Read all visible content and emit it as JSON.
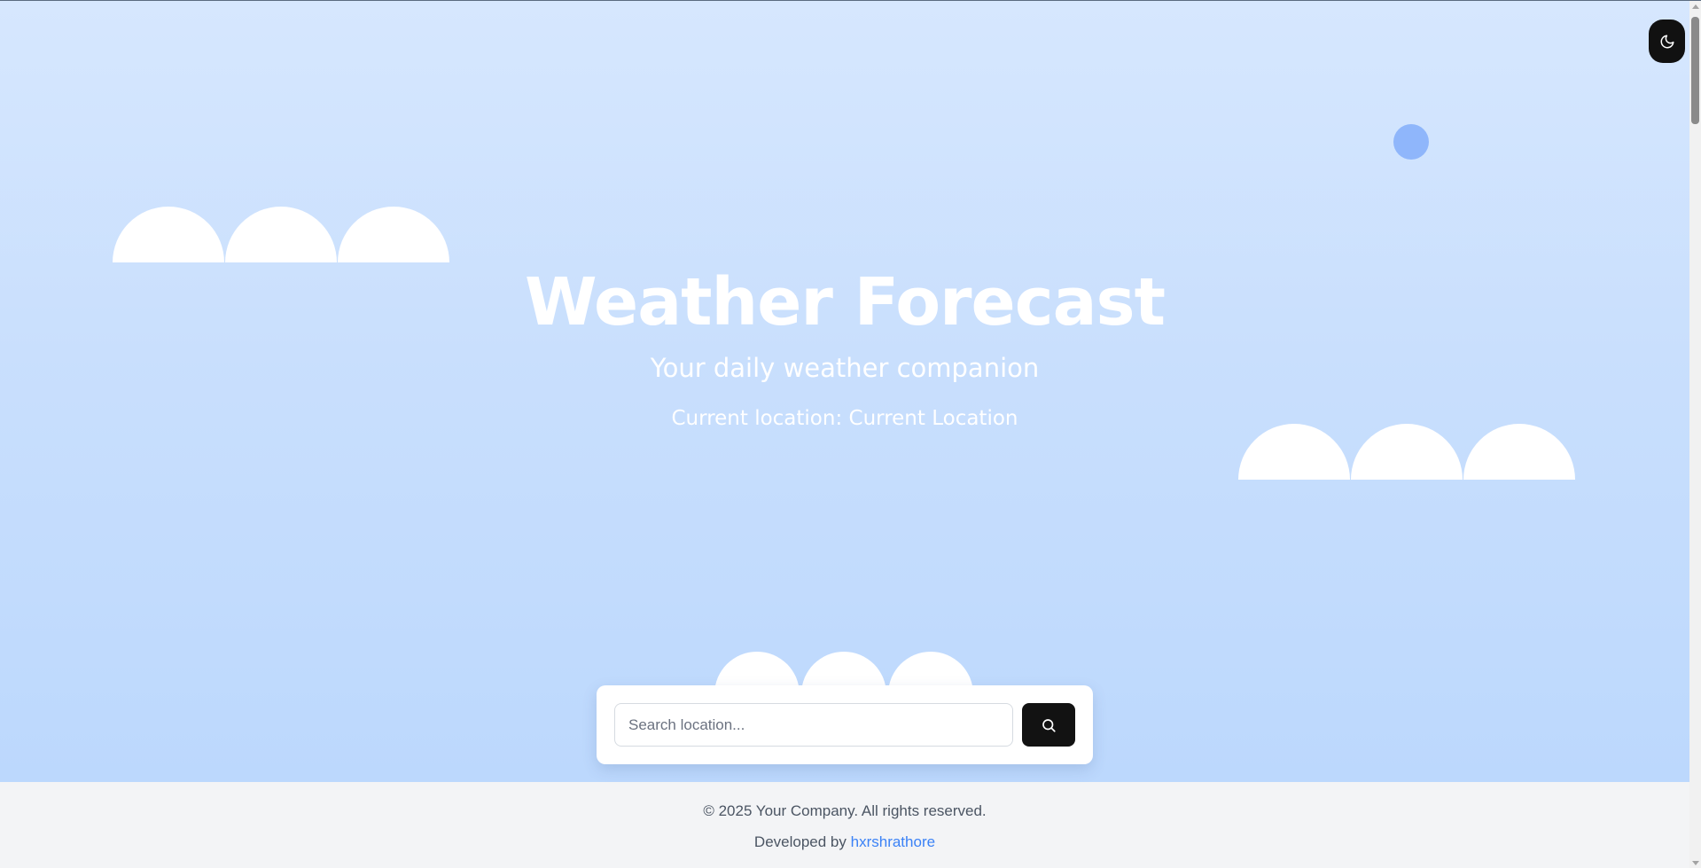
{
  "hero": {
    "title": "Weather Forecast",
    "subtitle": "Your daily weather companion",
    "location_text": "Current location: Current Location"
  },
  "theme_toggle": {
    "icon": "moon-icon"
  },
  "search": {
    "placeholder": "Search location...",
    "value": "",
    "button_icon": "search-icon"
  },
  "footer": {
    "copyright": "© 2025 Your Company. All rights reserved.",
    "developed_by_prefix": "Developed by",
    "developer_name": "hxrshrathore"
  },
  "colors": {
    "sky_top": "#d6e7fe",
    "sky_bottom": "#bcd8fd",
    "sun_dot": "#8fb6fb",
    "button_dark": "#121212",
    "link": "#3b82f6",
    "footer_bg": "#f3f4f6"
  }
}
